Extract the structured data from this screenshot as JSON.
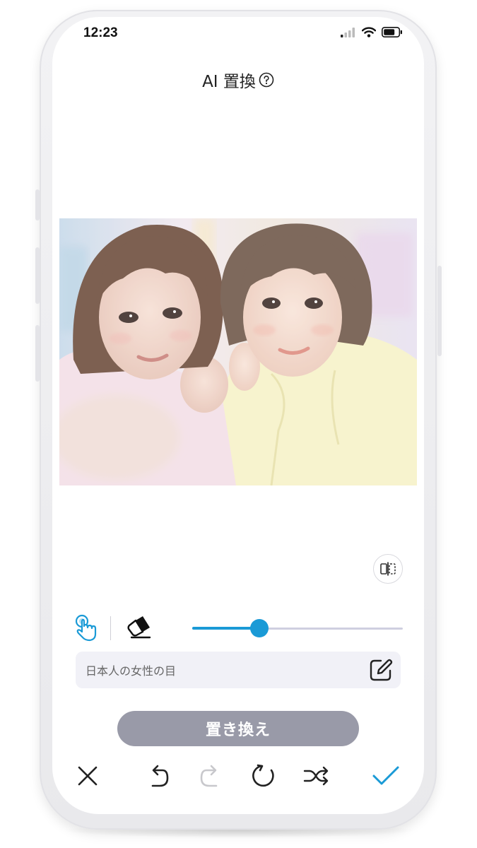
{
  "status_bar": {
    "time": "12:23",
    "icons": [
      "cellular-signal-icon",
      "wifi-icon",
      "battery-icon"
    ]
  },
  "header": {
    "title": "AI 置換",
    "help_icon": "question-circle-icon"
  },
  "canvas": {
    "image_description_icon": "photo",
    "compare_icon": "split-compare-icon"
  },
  "tools": {
    "brush_icon": "hand-brush-icon",
    "eraser_icon": "eraser-icon",
    "brush_size": 0.32,
    "brush_size_label": "brush-size-slider"
  },
  "prompt": {
    "value": "日本人の女性の目",
    "edit_icon": "edit-pencil-icon"
  },
  "actions": {
    "replace_label": "置き換え"
  },
  "bottom_toolbar": {
    "icons": [
      "close-icon",
      "undo-icon",
      "redo-icon",
      "reset-icon",
      "shuffle-icon",
      "confirm-check-icon"
    ]
  },
  "colors": {
    "accent": "#1a9ad6",
    "button_disabled": "#999aa8",
    "prompt_bg": "#f1f1f7",
    "disabled_icon": "#c8c8cc"
  }
}
